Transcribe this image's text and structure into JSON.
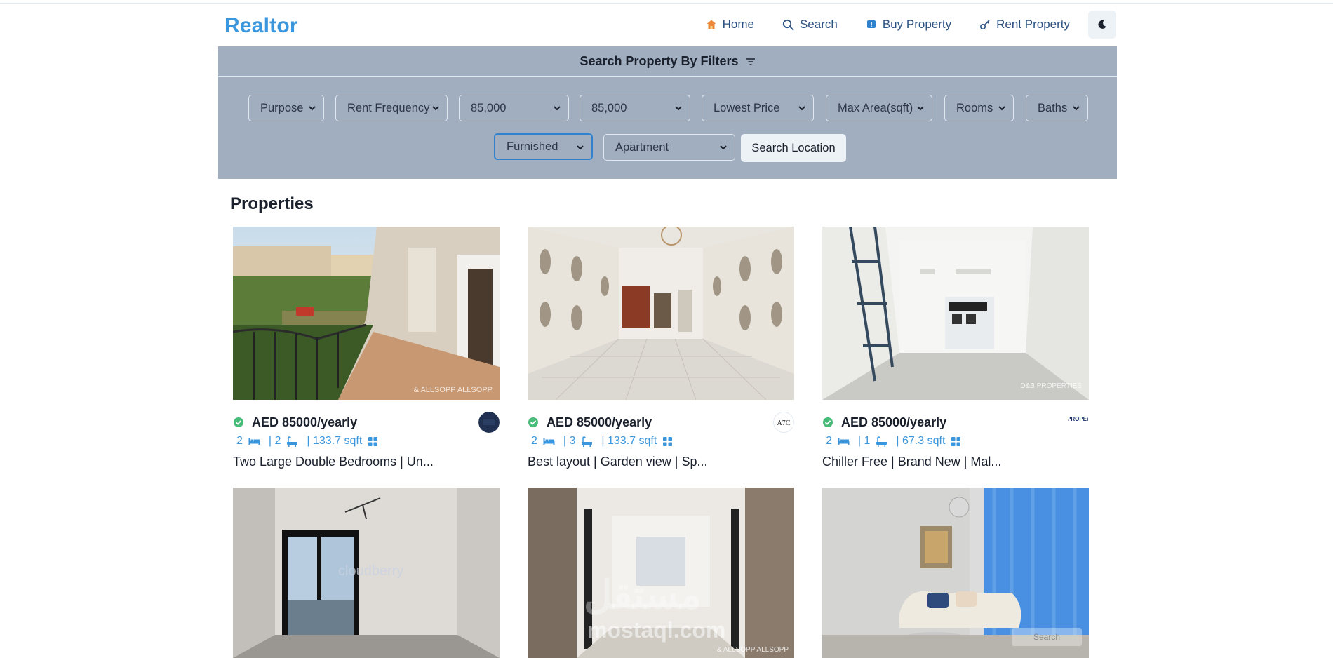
{
  "brand": "Realtor",
  "nav": {
    "home": "Home",
    "search": "Search",
    "buy": "Buy Property",
    "rent": "Rent Property"
  },
  "filters": {
    "heading": "Search Property By Filters",
    "purpose": "Purpose",
    "rent_frequency": "Rent Frequency",
    "min_price": "85,000",
    "max_price": "85,000",
    "sort": "Lowest Price",
    "max_area": "Max Area(sqft)",
    "rooms": "Rooms",
    "baths": "Baths",
    "furnish": "Furnished",
    "category": "Apartment",
    "search_location": "Search Location"
  },
  "section_title": "Properties",
  "properties": [
    {
      "price": "AED 85000/yearly",
      "rooms": "2",
      "baths": "| 2",
      "area": "| 133.7 sqft",
      "title": "Two Large Double Bedrooms | Un...",
      "agency": "ALLSOPP & ALLSOPP"
    },
    {
      "price": "AED 85000/yearly",
      "rooms": "2",
      "baths": "| 3",
      "area": "| 133.7 sqft",
      "title": "Best layout | Garden view | Sp...",
      "agency": "A7C"
    },
    {
      "price": "AED 85000/yearly",
      "rooms": "2",
      "baths": "| 1",
      "area": "| 67.3 sqft",
      "title": "Chiller Free | Brand New | Mal...",
      "agency": "D&B PROPERTIES"
    },
    {
      "price": "",
      "rooms": "",
      "baths": "",
      "area": "",
      "title": "",
      "agency": ""
    },
    {
      "price": "",
      "rooms": "",
      "baths": "",
      "area": "",
      "title": "",
      "agency": ""
    },
    {
      "price": "",
      "rooms": "",
      "baths": "",
      "area": "",
      "title": "",
      "agency": ""
    }
  ],
  "watermarks": {
    "allsopp": "& ALLSOPP ALLSOPP",
    "db": "D&B PROPERTIES",
    "cloudberry": "cloudberry",
    "mostaql_logo": "ﻣﺴﺘﻘﻞ",
    "mostaql": "mostaql.com",
    "search_chip": "Search"
  },
  "colors": {
    "accent": "#3a96dd",
    "filter_bg": "#a0aec0",
    "verified": "#48bb78"
  }
}
